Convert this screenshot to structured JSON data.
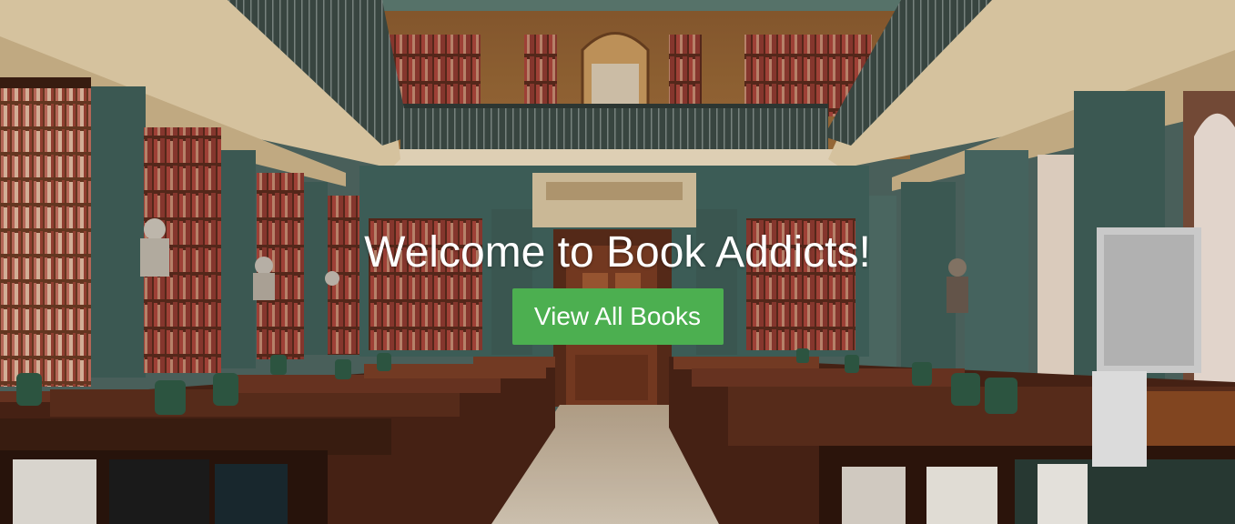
{
  "hero": {
    "title": "Welcome to Book Addicts!",
    "button_label": "View All Books",
    "button_color": "#4caf50",
    "background": "library-reading-room-photo"
  },
  "palette": {
    "wall_teal": "#3f5e58",
    "wood_dark": "#4a2616",
    "wood_mid": "#6b3a22",
    "cream_arch": "#d9c4a0",
    "book_red": "#9a3a34",
    "floor": "#c9b9a4"
  }
}
